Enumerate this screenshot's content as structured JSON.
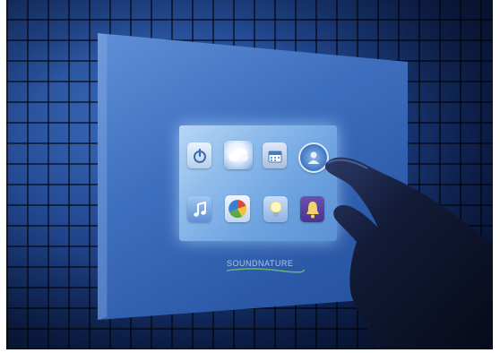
{
  "scene": {
    "description_free": true,
    "colors": {
      "wall": "#1c3f86",
      "panel": "#3e6fbe",
      "screen": "#8bb9ea",
      "hand": "#0b1020"
    }
  },
  "screen": {
    "icons": [
      {
        "name": "power-icon"
      },
      {
        "name": "cloud-icon"
      },
      {
        "name": "calendar-icon"
      },
      {
        "name": "user-icon"
      },
      {
        "name": "music-note-icon"
      },
      {
        "name": "pie-chart-icon"
      },
      {
        "name": "light-bulb-icon"
      },
      {
        "name": "bell-icon"
      }
    ]
  },
  "brand": {
    "logo_text": "SOUNDNATURE"
  }
}
